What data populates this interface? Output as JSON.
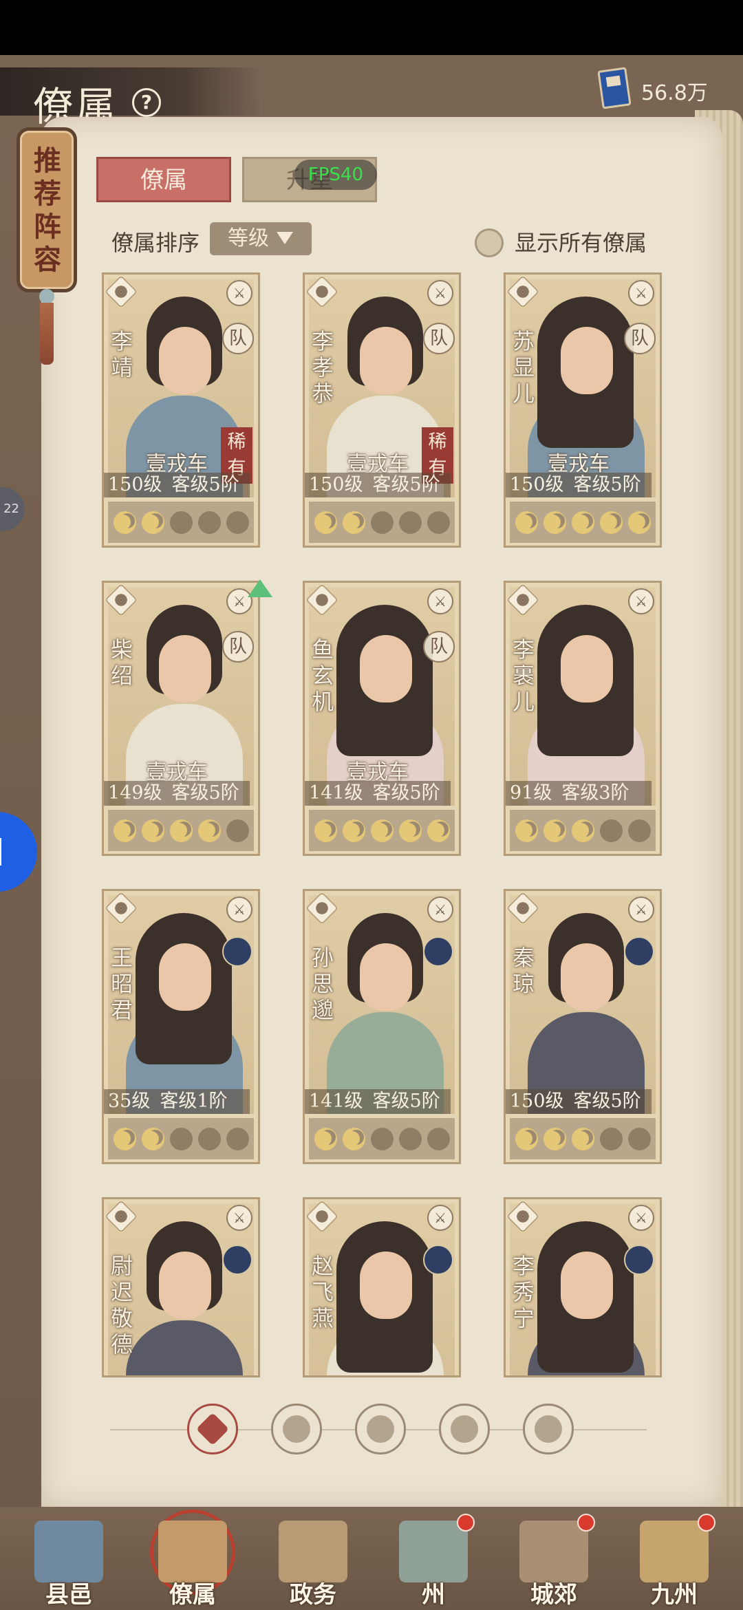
{
  "header": {
    "title": "僚属",
    "help_icon": "question-icon",
    "currency_icon": "book-icon",
    "currency_value": "56.8万"
  },
  "plaque": {
    "text": "推荐阵容"
  },
  "tabs": [
    {
      "label": "僚属",
      "active": true
    },
    {
      "label": "升星",
      "active": false
    }
  ],
  "fps_label": "FPS40",
  "sort": {
    "label": "僚属排序",
    "selected": "等级"
  },
  "show_all": {
    "label": "显示所有僚属",
    "checked": false
  },
  "cards": [
    {
      "name": "李靖",
      "vehicle": "壹戎车",
      "level": "150级",
      "rank": "客级5阶",
      "rare": "稀有",
      "badge": "队",
      "stars_on": 2,
      "robe": "blue"
    },
    {
      "name": "李孝恭",
      "vehicle": "壹戎车",
      "level": "150级",
      "rank": "客级5阶",
      "rare": "稀有",
      "badge": "队",
      "stars_on": 2,
      "robe": "cream"
    },
    {
      "name": "苏显儿",
      "vehicle": "壹戎车",
      "level": "150级",
      "rank": "客级5阶",
      "rare": "",
      "badge": "队",
      "stars_on": 5,
      "robe": "blue"
    },
    {
      "name": "柴绍",
      "vehicle": "壹戎车",
      "level": "149级",
      "rank": "客级5阶",
      "rare": "",
      "badge": "队",
      "stars_on": 4,
      "robe": "cream"
    },
    {
      "name": "鱼玄机",
      "vehicle": "壹戎车",
      "level": "141级",
      "rank": "客级5阶",
      "rare": "",
      "badge": "队",
      "stars_on": 5,
      "robe": "rose"
    },
    {
      "name": "李裹儿",
      "vehicle": "",
      "level": "91级",
      "rank": "客级3阶",
      "rare": "",
      "badge": "",
      "stars_on": 3,
      "robe": "rose"
    },
    {
      "name": "王昭君",
      "vehicle": "",
      "level": "35级",
      "rank": "客级1阶",
      "rare": "",
      "badge": "",
      "stars_on": 2,
      "robe": "blue"
    },
    {
      "name": "孙思邈",
      "vehicle": "",
      "level": "141级",
      "rank": "客级5阶",
      "rare": "",
      "badge": "",
      "stars_on": 2,
      "robe": "green"
    },
    {
      "name": "秦琼",
      "vehicle": "",
      "level": "150级",
      "rank": "客级5阶",
      "rare": "",
      "badge": "",
      "stars_on": 3,
      "robe": "dark"
    },
    {
      "name": "尉迟敬德",
      "vehicle": "",
      "level": "",
      "rank": "",
      "rare": "",
      "badge": "",
      "stars_on": 0,
      "robe": "dark"
    },
    {
      "name": "赵飞燕",
      "vehicle": "",
      "level": "",
      "rank": "",
      "rare": "",
      "badge": "",
      "stars_on": 0,
      "robe": "cream"
    },
    {
      "name": "李秀宁",
      "vehicle": "",
      "level": "",
      "rank": "",
      "rare": "",
      "badge": "",
      "stars_on": 0,
      "robe": "dark"
    }
  ],
  "filters": [
    {
      "icon": "all-icon",
      "active": true
    },
    {
      "icon": "helmet-icon",
      "active": false
    },
    {
      "icon": "gourd-icon",
      "active": false
    },
    {
      "icon": "fan-icon",
      "active": false
    },
    {
      "icon": "beast-icon",
      "active": false
    }
  ],
  "side": {
    "pill_text": "22"
  },
  "bottom_nav": [
    {
      "label": "县邑",
      "dot": false,
      "active": false
    },
    {
      "label": "僚属",
      "dot": false,
      "active": true
    },
    {
      "label": "政务",
      "dot": false,
      "active": false
    },
    {
      "label": "州",
      "dot": true,
      "active": false
    },
    {
      "label": "城郊",
      "dot": true,
      "active": false
    },
    {
      "label": "九州",
      "dot": true,
      "active": false
    }
  ]
}
